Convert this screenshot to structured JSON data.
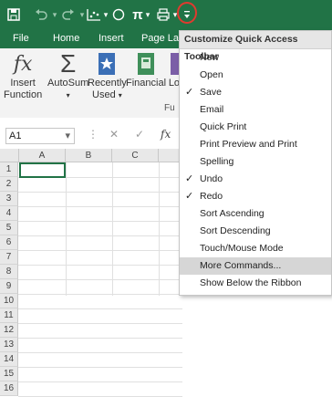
{
  "qat": {
    "icons": [
      "save-icon",
      "undo-icon",
      "redo-icon",
      "chart-icon",
      "circle-shape-icon",
      "pi-icon",
      "print-preview-icon",
      "customize-qat-icon"
    ]
  },
  "tabs": [
    "File",
    "Home",
    "Insert",
    "Page Lay"
  ],
  "ribbon": {
    "buttons": [
      {
        "label1": "Insert",
        "label2": "Function"
      },
      {
        "label1": "AutoSum",
        "label2": ""
      },
      {
        "label1": "Recently",
        "label2": "Used"
      },
      {
        "label1": "Financial",
        "label2": ""
      },
      {
        "label1": "Log",
        "label2": ""
      }
    ],
    "group_label": "Fu"
  },
  "formula": {
    "name_box": "A1",
    "fx": "fx"
  },
  "grid": {
    "columns": [
      "A",
      "B",
      "C"
    ],
    "rows": [
      "1",
      "2",
      "3",
      "4",
      "5",
      "6",
      "7",
      "8",
      "9",
      "10",
      "11",
      "12",
      "13",
      "14",
      "15",
      "16"
    ]
  },
  "menu": {
    "title": "Customize Quick Access Toolbar",
    "items": [
      {
        "label": "New",
        "checked": false
      },
      {
        "label": "Open",
        "checked": false
      },
      {
        "label": "Save",
        "checked": true
      },
      {
        "label": "Email",
        "checked": false
      },
      {
        "label": "Quick Print",
        "checked": false
      },
      {
        "label": "Print Preview and Print",
        "checked": false
      },
      {
        "label": "Spelling",
        "checked": false
      },
      {
        "label": "Undo",
        "checked": true
      },
      {
        "label": "Redo",
        "checked": true
      },
      {
        "label": "Sort Ascending",
        "checked": false
      },
      {
        "label": "Sort Descending",
        "checked": false
      },
      {
        "label": "Touch/Mouse Mode",
        "checked": false
      },
      {
        "label": "More Commands...",
        "checked": false,
        "highlighted": true
      },
      {
        "label": "Show Below the Ribbon",
        "checked": false
      }
    ],
    "check_glyph": "✓"
  },
  "colors": {
    "accent": "#217346",
    "highlight_circle": "#e03a2f"
  }
}
